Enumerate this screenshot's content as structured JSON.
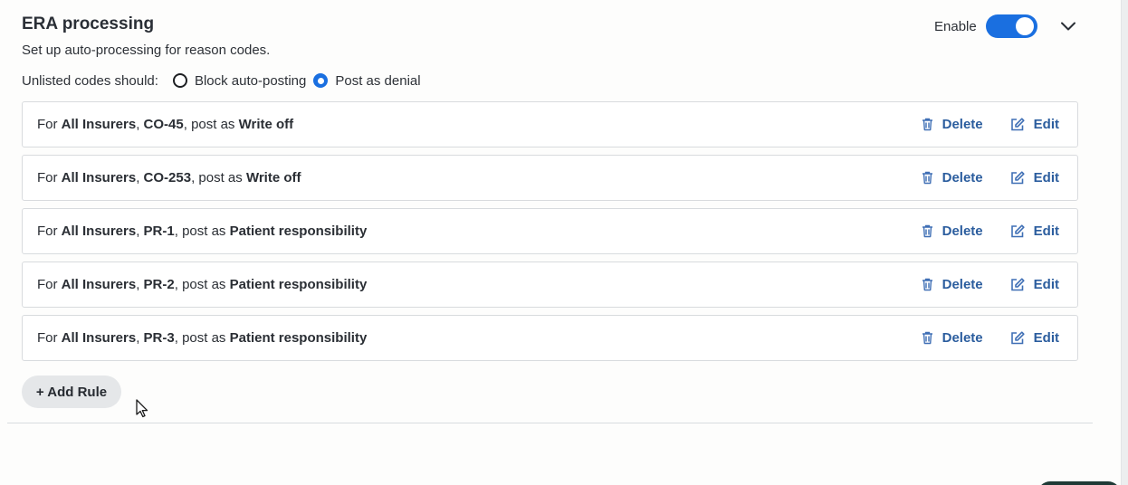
{
  "section": {
    "title": "ERA processing",
    "subtitle": "Set up auto-processing for reason codes.",
    "enable_label": "Enable",
    "enabled": true
  },
  "unlisted": {
    "label": "Unlisted codes should:",
    "options": [
      {
        "label": "Block auto-posting",
        "selected": false
      },
      {
        "label": "Post as denial",
        "selected": true
      }
    ]
  },
  "rules": [
    {
      "prefix": "For ",
      "insurer": "All Insurers",
      "sep": ", ",
      "code": "CO-45",
      "mid": ", post as ",
      "action": "Write off"
    },
    {
      "prefix": "For ",
      "insurer": "All Insurers",
      "sep": ", ",
      "code": "CO-253",
      "mid": ", post as ",
      "action": "Write off"
    },
    {
      "prefix": "For ",
      "insurer": "All Insurers",
      "sep": ", ",
      "code": "PR-1",
      "mid": ", post as ",
      "action": "Patient responsibility"
    },
    {
      "prefix": "For ",
      "insurer": "All Insurers",
      "sep": ", ",
      "code": "PR-2",
      "mid": ", post as ",
      "action": "Patient responsibility"
    },
    {
      "prefix": "For ",
      "insurer": "All Insurers",
      "sep": ", ",
      "code": "PR-3",
      "mid": ", post as ",
      "action": "Patient responsibility"
    }
  ],
  "rule_actions": {
    "delete_label": "Delete",
    "edit_label": "Edit"
  },
  "add_rule_label": "+ Add Rule",
  "icons": {
    "delete": "trash-icon",
    "edit": "edit-icon",
    "expand": "chevron-down-icon",
    "cursor": "mouse-pointer-icon"
  },
  "colors": {
    "accent": "#1a6fe0",
    "link": "#2b5d9e",
    "icon": "#3f6fb5"
  }
}
